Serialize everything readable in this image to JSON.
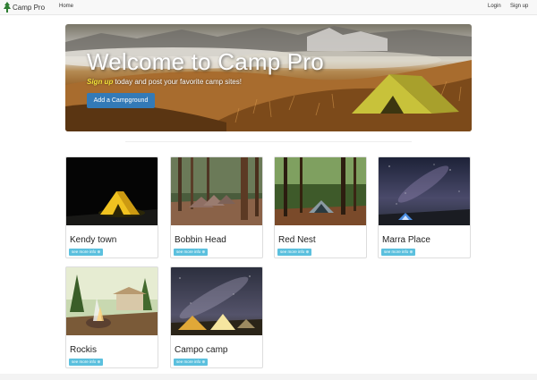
{
  "navbar": {
    "brand": "Camp Pro",
    "home": "Home",
    "login": "Login",
    "signup": "Sign up"
  },
  "hero": {
    "title": "Welcome to Camp Pro",
    "signup_link": "Sign up",
    "subtitle": " today and post your favorite camp sites!",
    "button": "Add a Campground"
  },
  "campgrounds": [
    {
      "name": "Kendy town",
      "button": "see more info ⊕"
    },
    {
      "name": "Bobbin Head",
      "button": "see more info ⊕"
    },
    {
      "name": "Red Nest",
      "button": "see more info ⊕"
    },
    {
      "name": "Marra Place",
      "button": "see more info ⊕"
    },
    {
      "name": "Rockis",
      "button": "see more info ⊕"
    },
    {
      "name": "Campo camp",
      "button": "see more info ⊕"
    }
  ],
  "colors": {
    "primary_button": "#337ab7",
    "info_button": "#5bc0de",
    "highlight": "#f4e33a",
    "navbar_bg": "#f8f8f8"
  }
}
